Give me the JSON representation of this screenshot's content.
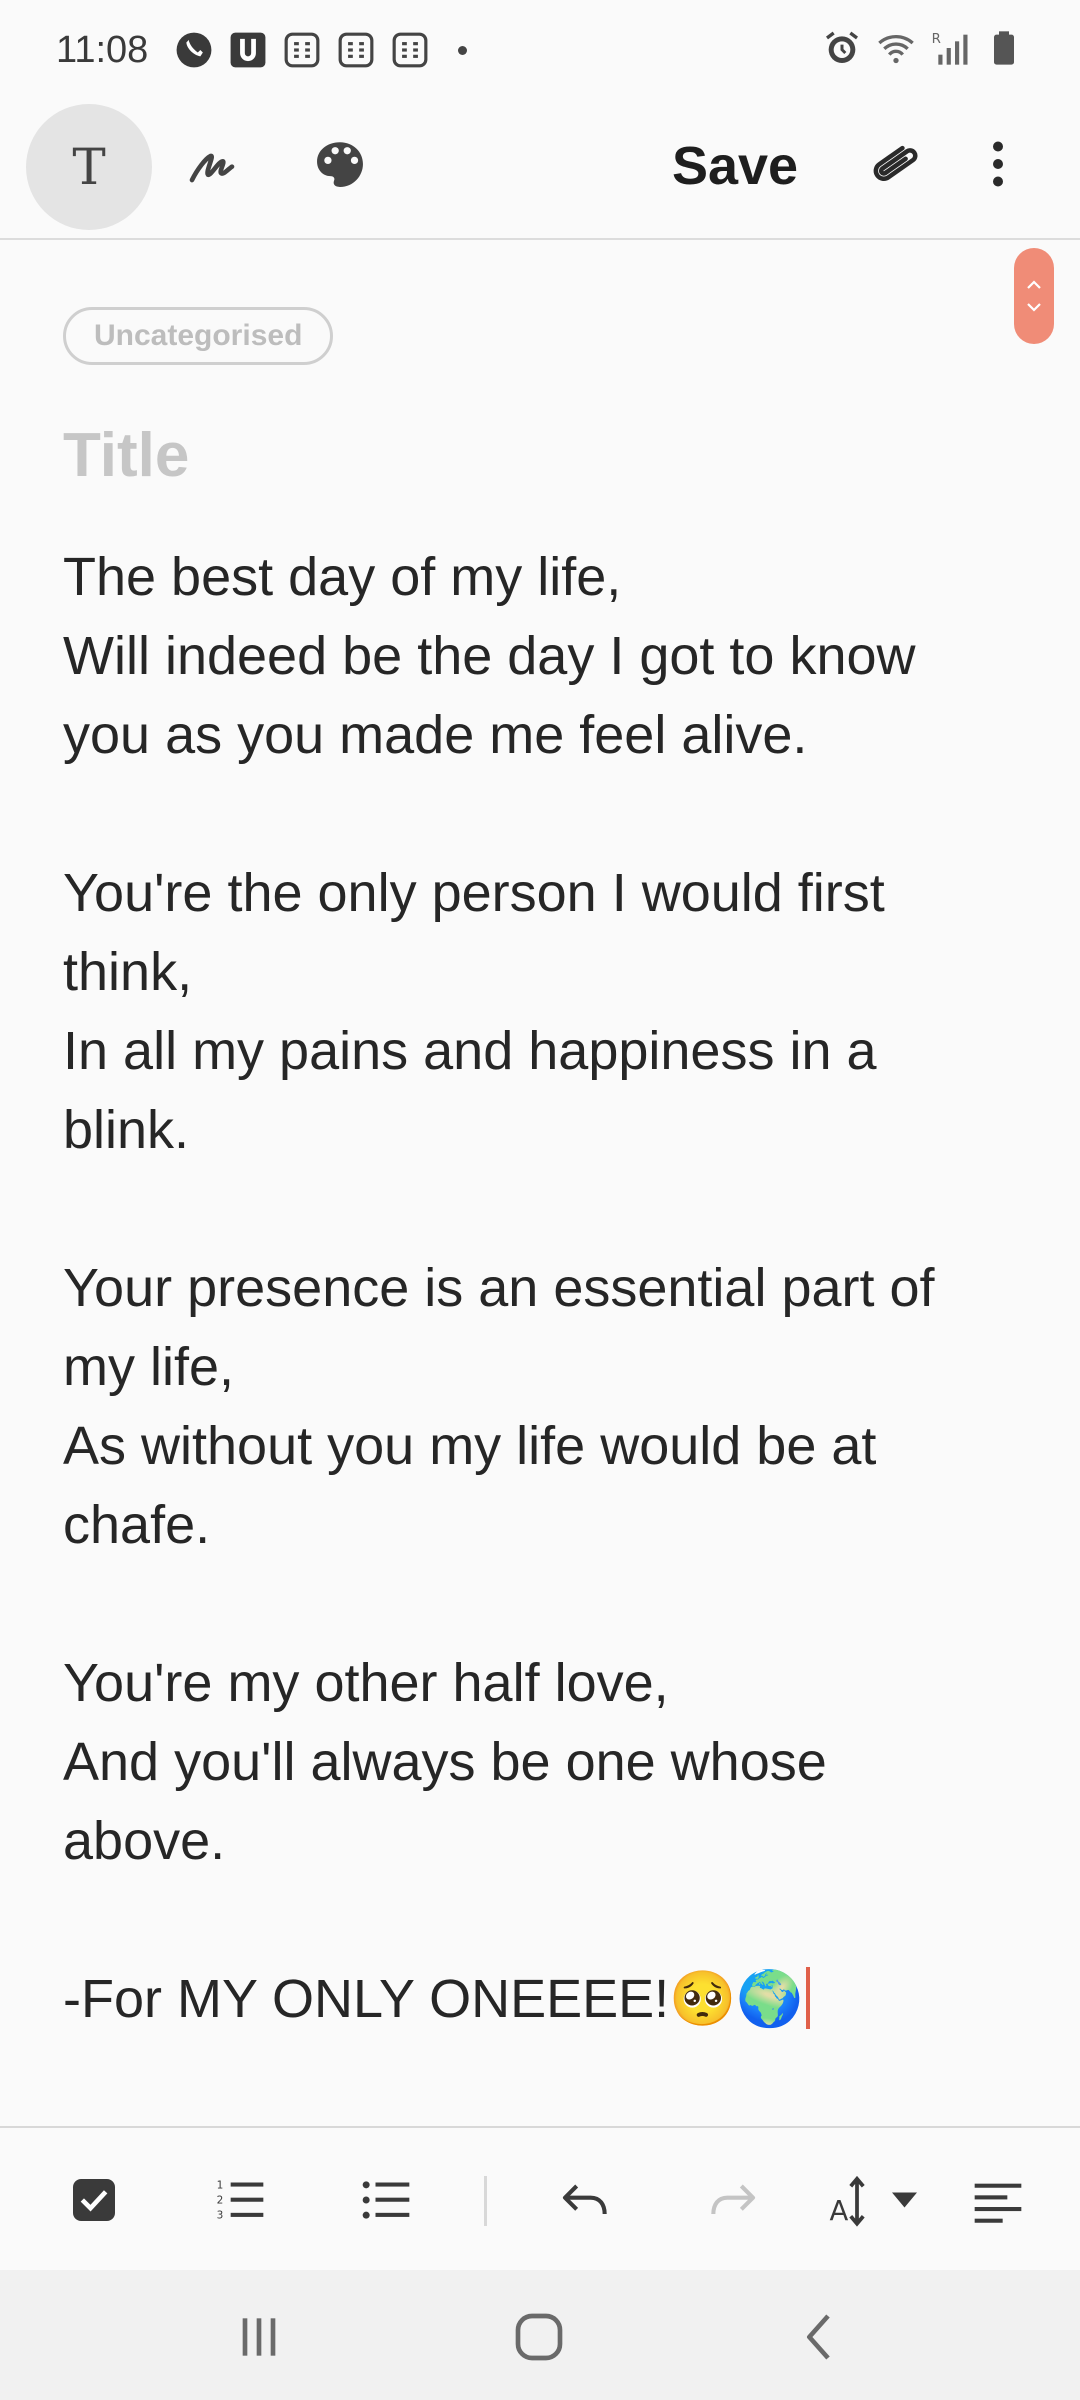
{
  "status_bar": {
    "time": "11:08",
    "left_icons": [
      "phone-icon",
      "u-app-icon",
      "calculator-icon",
      "calculator-icon",
      "calculator-icon",
      "dot-icon"
    ],
    "right_icons": [
      "alarm-icon",
      "wifi-icon",
      "signal-icon",
      "battery-icon"
    ]
  },
  "toolbar": {
    "text_mode_label": "T",
    "save_label": "Save",
    "icons": [
      "text-mode-icon",
      "pen-icon",
      "palette-icon",
      "attachment-icon",
      "more-vert-icon"
    ]
  },
  "note": {
    "category": "Uncategorised",
    "title_placeholder": "Title",
    "lines": [
      "The best day of my life,",
      "Will indeed be the day I got to know",
      "you as you made me feel alive.",
      "",
      "You're the only person I would first",
      "think,",
      "In all my pains and happiness in a",
      "blink.",
      "",
      "Your presence is an essential part of",
      "my life,",
      "As without you my life would be at",
      "chafe.",
      "",
      "You're my other half love,",
      "And you'll always be one whose",
      "above.",
      "",
      "-For MY ONLY ONEEEE!🥺🌍"
    ]
  },
  "format_bar": {
    "icons": [
      "checkbox-icon",
      "numbered-list-icon",
      "bullet-list-icon",
      "undo-icon",
      "redo-icon",
      "text-size-icon",
      "align-left-icon"
    ]
  },
  "nav_bar": {
    "icons": [
      "recent-apps-icon",
      "home-icon",
      "back-icon"
    ]
  },
  "colors": {
    "accent": "#f08c77",
    "cursor": "#e0604a"
  }
}
